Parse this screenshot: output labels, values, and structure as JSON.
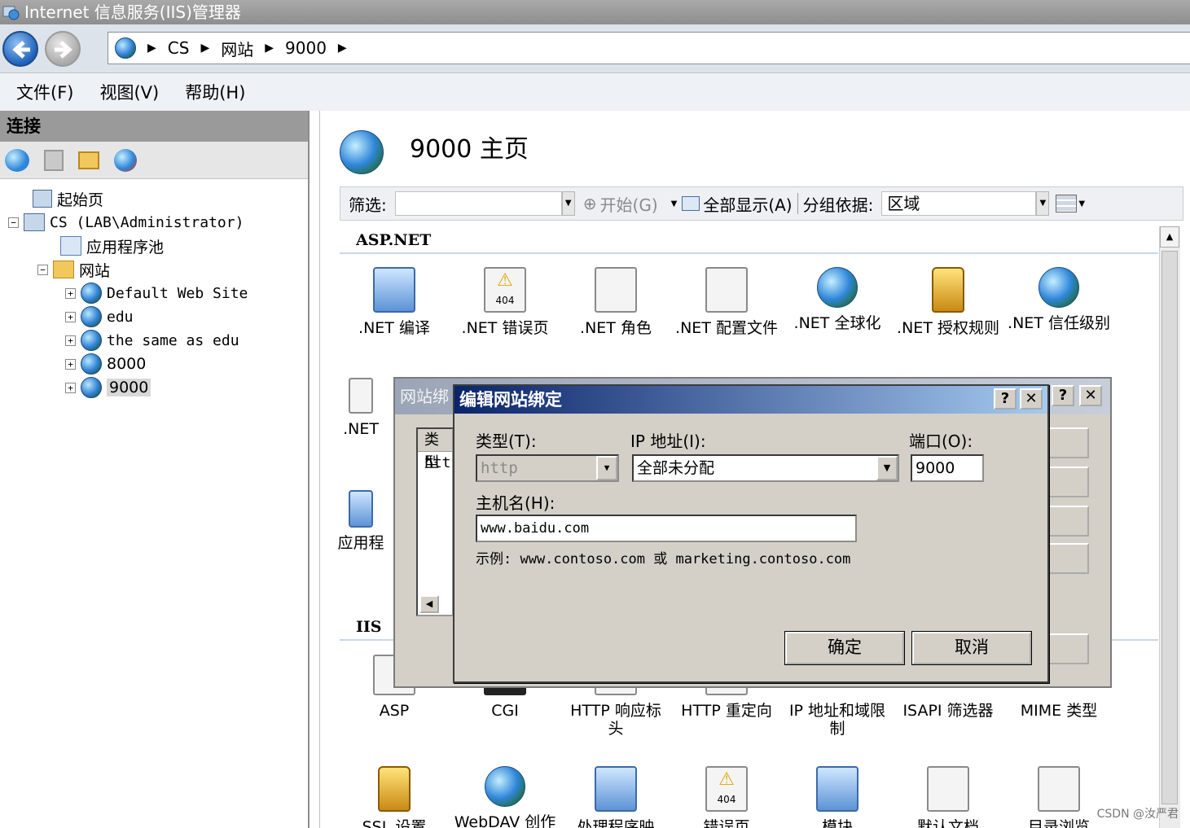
{
  "window": {
    "title": "Internet 信息服务(IIS)管理器"
  },
  "address": {
    "segments": [
      "CS",
      "网站",
      "9000"
    ]
  },
  "menu": [
    "文件(F)",
    "视图(V)",
    "帮助(H)"
  ],
  "connections": {
    "header": "连接",
    "tree": {
      "start_page": "起始页",
      "server": "CS (LAB\\Administrator)",
      "app_pools": "应用程序池",
      "sites": "网站",
      "site_items": [
        "Default Web Site",
        "edu",
        "the same as edu",
        "8000",
        "9000"
      ]
    }
  },
  "main": {
    "title": "9000 主页",
    "filter": {
      "label": "筛选:",
      "start": "开始(G)",
      "show_all": "全部显示(A)",
      "group_by_label": "分组依据:",
      "group_by_value": "区域"
    },
    "sections": {
      "aspnet": "ASP.NET",
      "iis": "IIS"
    },
    "aspnet_features": [
      ".NET 编译",
      ".NET 错误页",
      ".NET 角色",
      ".NET 配置文件",
      ".NET 全球化",
      ".NET 授权规则",
      ".NET 信任级别"
    ],
    "aspnet_row2_partial": [
      ".NET",
      "应用程"
    ],
    "iis_features": [
      "ASP",
      "CGI",
      "HTTP 响应标头",
      "HTTP 重定向",
      "IP 地址和域限制",
      "ISAPI 筛选器",
      "MIME 类型"
    ],
    "iis_row2_features": [
      "SSL 设置",
      "WebDAV 创作",
      "处理程序映",
      "错误页",
      "模块",
      "默认文档",
      "目录浏览"
    ]
  },
  "bindings_dialog": {
    "title_partial": "网站绑",
    "list_header_partial": "类型",
    "list_cell_partial": "htt",
    "help_button": "?",
    "close_button": "✕"
  },
  "edit_dialog": {
    "title": "编辑网站绑定",
    "help_button": "?",
    "close_button": "✕",
    "type_label": "类型(T):",
    "type_value": "http",
    "ip_label": "IP 地址(I):",
    "ip_value": "全部未分配",
    "port_label": "端口(O):",
    "port_value": "9000",
    "host_label": "主机名(H):",
    "host_value": "www.baidu.com",
    "example": "示例: www.contoso.com 或 marketing.contoso.com",
    "ok": "确定",
    "cancel": "取消"
  },
  "watermark": "CSDN @汝严君"
}
